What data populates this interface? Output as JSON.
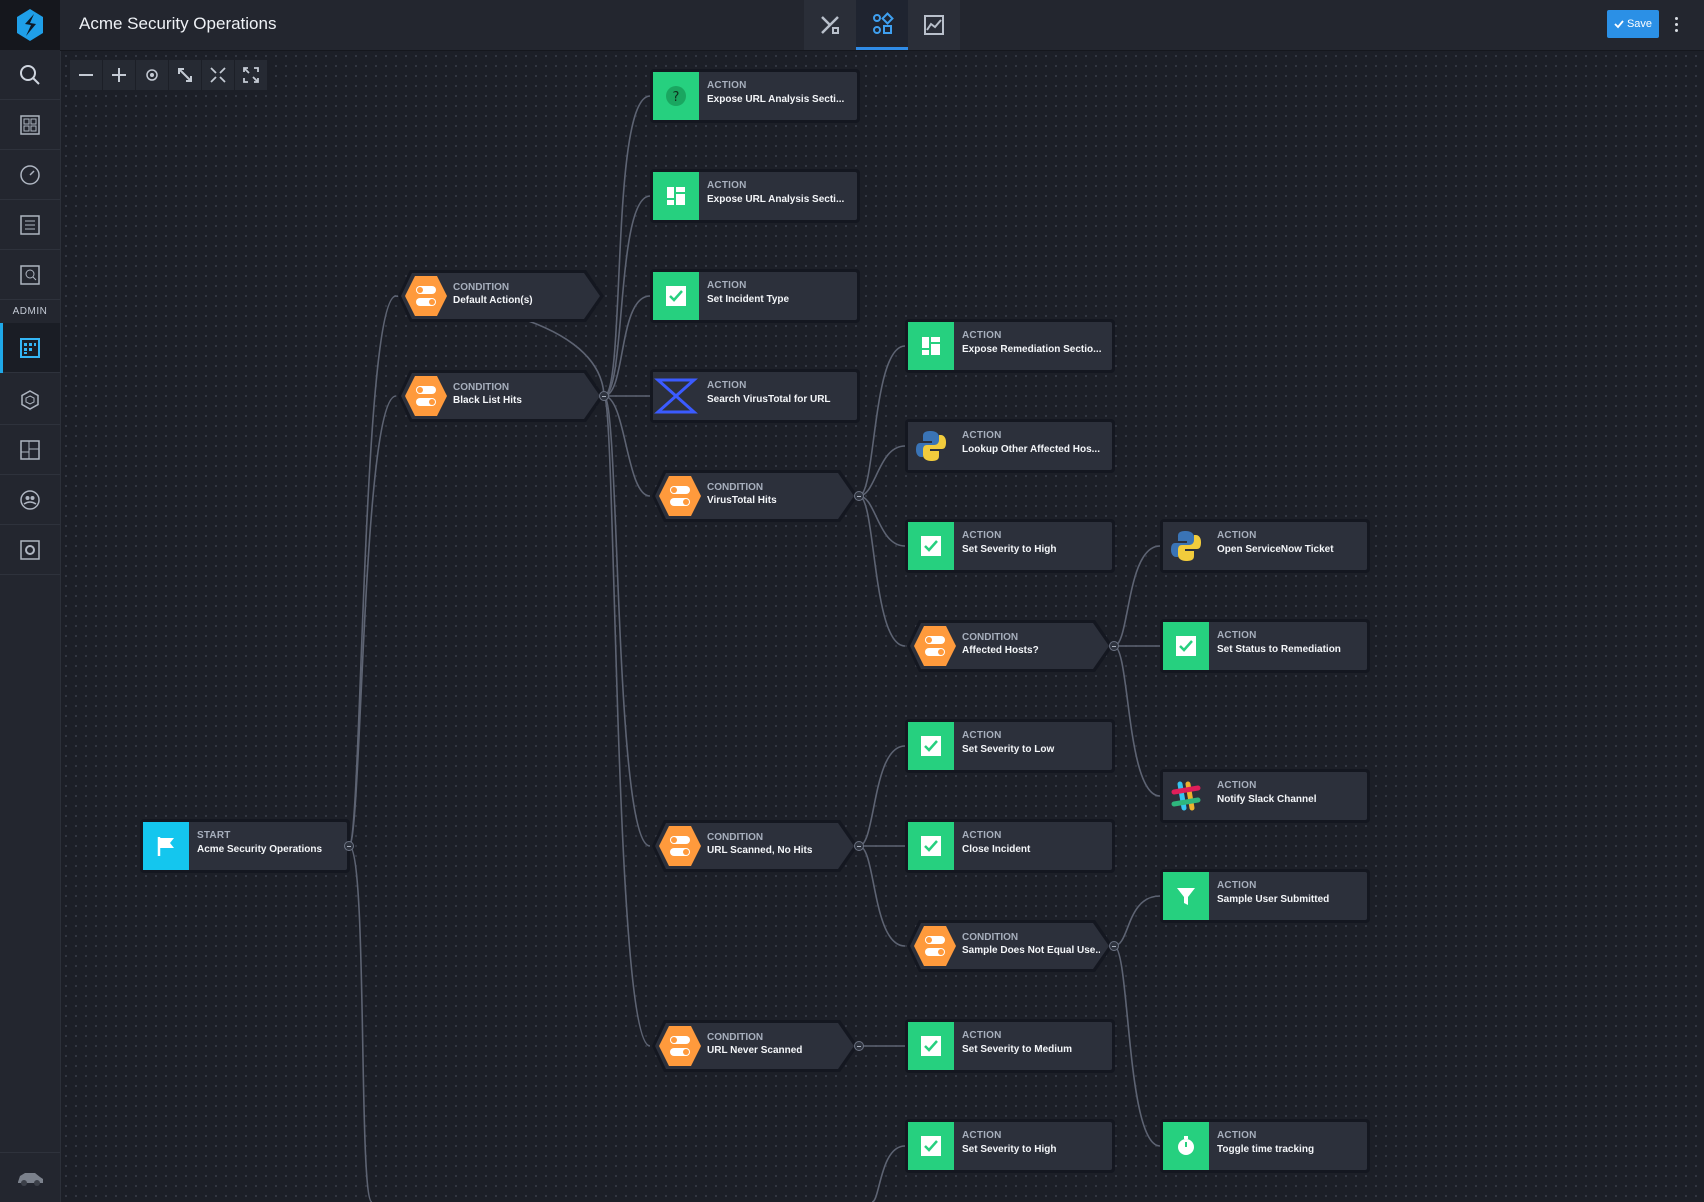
{
  "header": {
    "title": "Acme Security Operations",
    "save_label": "Save",
    "view_tabs": [
      "playbook-designer",
      "workflow",
      "analytics"
    ]
  },
  "sidebar": {
    "items": [
      "search-icon",
      "dashboard-icon",
      "gauge-icon",
      "list-icon",
      "investigate-icon"
    ],
    "admin_label": "ADMIN",
    "admin_items": [
      "playbooks-icon",
      "packages-icon",
      "layouts-icon",
      "users-icon",
      "settings-icon"
    ]
  },
  "zoom_tools": [
    "zoom-out-icon",
    "zoom-in-icon",
    "center-icon",
    "fit-icon",
    "collapse-icon",
    "expand-icon"
  ],
  "nodes": [
    {
      "id": "n1",
      "type": "ACTION",
      "label": "Expose URL Analysis Secti...",
      "icon": "help"
    },
    {
      "id": "n2",
      "type": "ACTION",
      "label": "Expose URL Analysis Secti...",
      "icon": "layout"
    },
    {
      "id": "n3",
      "type": "ACTION",
      "label": "Set Incident Type",
      "icon": "check"
    },
    {
      "id": "n4",
      "type": "ACTION",
      "label": "Search VirusTotal for URL",
      "icon": "sigma"
    },
    {
      "id": "n5",
      "type": "ACTION",
      "label": "Expose Remediation Sectio...",
      "icon": "layout"
    },
    {
      "id": "n6",
      "type": "ACTION",
      "label": "Lookup Other Affected Hos...",
      "icon": "python"
    },
    {
      "id": "n7",
      "type": "ACTION",
      "label": "Set Severity to High",
      "icon": "check"
    },
    {
      "id": "n8",
      "type": "ACTION",
      "label": "Open ServiceNow Ticket",
      "icon": "python"
    },
    {
      "id": "n9",
      "type": "ACTION",
      "label": "Set Status to Remediation",
      "icon": "check"
    },
    {
      "id": "n10",
      "type": "ACTION",
      "label": "Set Severity to Low",
      "icon": "check"
    },
    {
      "id": "n11",
      "type": "ACTION",
      "label": "Notify Slack Channel",
      "icon": "slack"
    },
    {
      "id": "n12",
      "type": "ACTION",
      "label": "Close Incident",
      "icon": "check"
    },
    {
      "id": "n13",
      "type": "ACTION",
      "label": "Sample User Submitted",
      "icon": "filter"
    },
    {
      "id": "n14",
      "type": "ACTION",
      "label": "Set Severity to Medium",
      "icon": "check"
    },
    {
      "id": "n15",
      "type": "ACTION",
      "label": "Set Severity to High",
      "icon": "check"
    },
    {
      "id": "n16",
      "type": "ACTION",
      "label": "Toggle time tracking",
      "icon": "timer"
    },
    {
      "id": "s1",
      "type": "START",
      "label": "Acme Security Operations",
      "icon": "flag"
    }
  ],
  "conditions": [
    {
      "id": "c1",
      "type": "CONDITION",
      "label": "Default Action(s)"
    },
    {
      "id": "c2",
      "type": "CONDITION",
      "label": "Black List Hits"
    },
    {
      "id": "c3",
      "type": "CONDITION",
      "label": "VirusTotal Hits"
    },
    {
      "id": "c4",
      "type": "CONDITION",
      "label": "Affected Hosts?"
    },
    {
      "id": "c5",
      "type": "CONDITION",
      "label": "URL Scanned, No Hits"
    },
    {
      "id": "c6",
      "type": "CONDITION",
      "label": "Sample Does Not Equal Use..."
    },
    {
      "id": "c7",
      "type": "CONDITION",
      "label": "URL Never Scanned"
    }
  ],
  "colors": {
    "action_green": "#26d07f",
    "condition_orange": "#ff9a3c",
    "start_cyan": "#14c6ee",
    "accent_blue": "#2b90e6"
  }
}
